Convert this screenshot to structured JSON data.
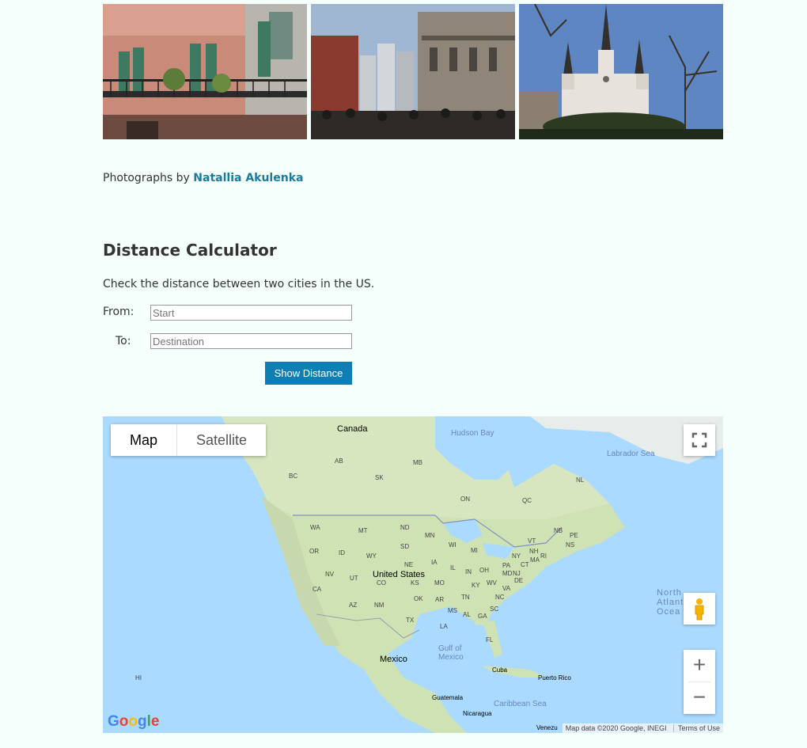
{
  "photos": {
    "credit_prefix": "Photographs by",
    "credit_name": "Natallia Akulenka"
  },
  "calculator": {
    "title": "Distance Calculator",
    "description": "Check the distance between two cities in the US.",
    "from_label": "From:",
    "to_label": "To:",
    "from_placeholder": "Start",
    "to_placeholder": "Destination",
    "button_label": "Show Distance"
  },
  "map": {
    "type_map": "Map",
    "type_satellite": "Satellite",
    "zoom_in": "+",
    "zoom_out": "−",
    "attribution": "Map data ©2020 Google, INEGI",
    "terms": "Terms of Use",
    "logo": "Google",
    "labels": {
      "canada": "Canada",
      "united_states": "United States",
      "mexico": "Mexico",
      "hudson_bay": "Hudson Bay",
      "labrador_sea": "Labrador Sea",
      "north_atlantic": "North Atlant Ocea",
      "gulf_of_mexico": "Gulf of Mexico",
      "caribbean_sea": "Caribbean Sea",
      "cuba": "Cuba",
      "puerto_rico": "Puerto Rico",
      "guatemala": "Guatemala",
      "nicaragua": "Nicaragua",
      "venezuela": "Venezu",
      "AB": "AB",
      "MB": "MB",
      "BC": "BC",
      "SK": "SK",
      "ON": "ON",
      "QC": "QC",
      "NL": "NL",
      "NB": "NB",
      "PE": "PE",
      "NS": "NS",
      "WA": "WA",
      "MT": "MT",
      "ND": "ND",
      "MN": "MN",
      "OR": "OR",
      "ID": "ID",
      "SD": "SD",
      "WI": "WI",
      "MI": "MI",
      "WY": "WY",
      "NE": "NE",
      "IA": "IA",
      "IL": "IL",
      "IN": "IN",
      "OH": "OH",
      "NY": "NY",
      "VT": "VT",
      "NH": "NH",
      "MA": "MA",
      "PA": "PA",
      "NJ": "NJ",
      "MD": "MD",
      "DE": "DE",
      "CT": "CT",
      "RI": "RI",
      "NV": "NV",
      "UT": "UT",
      "CO": "CO",
      "KS": "KS",
      "MO": "MO",
      "KY": "KY",
      "WV": "WV",
      "VA": "VA",
      "CA": "CA",
      "AZ": "AZ",
      "NM": "NM",
      "OK": "OK",
      "AR": "AR",
      "TN": "TN",
      "NC": "NC",
      "SC": "SC",
      "MS": "MS",
      "AL": "AL",
      "GA": "GA",
      "TX": "TX",
      "LA": "LA",
      "FL": "FL",
      "HI": "HI"
    }
  }
}
